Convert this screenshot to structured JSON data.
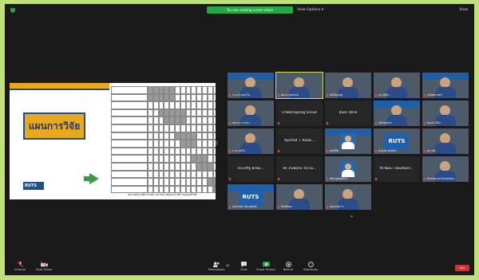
{
  "top_bar": {
    "share_banner": "You are viewing screen share",
    "view_options": "View Options ▾",
    "view": "View"
  },
  "slide": {
    "title": "แผนการวิจัย",
    "logo": "RUTS",
    "footer": "คณะเทคโนโลยีการเกษตร มหาวิทยาลัยเทคโนโลยีราชมงคลศรีวิชัย"
  },
  "participants": [
    {
      "name": "ร.อ.ดร.ทองใบ",
      "type": "video"
    },
    {
      "name": "ผศ.ดร.สมชาย",
      "type": "video"
    },
    {
      "name": "Kittipong",
      "type": "video"
    },
    {
      "name": "ดร.สุนิสา",
      "type": "video"
    },
    {
      "name": "คณิตศาสตร์",
      "type": "video"
    },
    {
      "name": "ผศ.ดร.วรรณา",
      "type": "video"
    },
    {
      "name": "Chakkrapong Srisuk",
      "type": "name"
    },
    {
      "name": "สุนทร สุขใจ",
      "type": "name"
    },
    {
      "name": "Waraporn",
      "type": "video"
    },
    {
      "name": "ผศ.ดร.ปิยะ",
      "type": "video"
    },
    {
      "name": "นาง สมใจ",
      "type": "video"
    },
    {
      "name": "Apichat T. Kanb...",
      "type": "name"
    },
    {
      "name": "สุทธิชัย",
      "type": "video"
    },
    {
      "name": "Supot Jaidee",
      "type": "video"
    },
    {
      "name": "สุภาพร",
      "type": "video"
    },
    {
      "name": "ประเสริฐ พรหม...",
      "type": "name"
    },
    {
      "name": "รศ. ธนพฤกษ์ ใจงาม...",
      "type": "name"
    },
    {
      "name": "Wongsakorn",
      "type": "video"
    },
    {
      "name": "ธีรวัฒน์ / หอมจันทร์...",
      "type": "name"
    },
    {
      "name": "Ramonya Kaewtha...",
      "type": "video"
    },
    {
      "name": "Apichat Songwat",
      "type": "video"
    },
    {
      "name": "พิมพ์ชนก",
      "type": "video"
    },
    {
      "name": "Apichat S.",
      "type": "video"
    }
  ],
  "toolbar": {
    "unmute": "Unmute",
    "start_video": "Start Video",
    "participants": "Participants",
    "participants_count": "45",
    "chat": "Chat",
    "share_screen": "Share Screen",
    "record": "Record",
    "reactions": "Reactions",
    "end": "End"
  }
}
